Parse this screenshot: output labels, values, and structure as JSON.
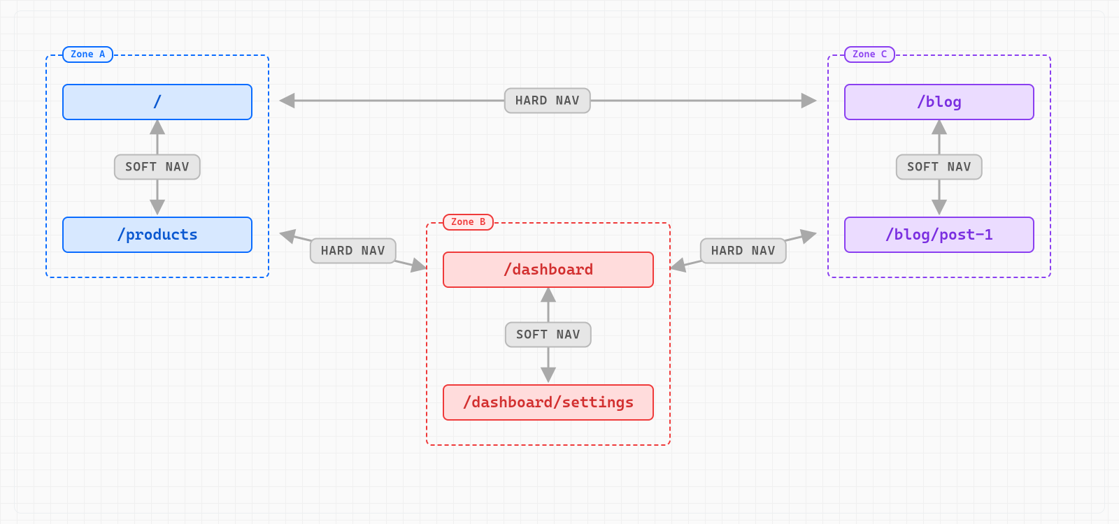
{
  "labels": {
    "soft_nav": "SOFT NAV",
    "hard_nav": "HARD NAV"
  },
  "zones": {
    "a": {
      "title": "Zone A",
      "routes": [
        "/",
        "/products"
      ]
    },
    "b": {
      "title": "Zone B",
      "routes": [
        "/dashboard",
        "/dashboard/settings"
      ]
    },
    "c": {
      "title": "Zone C",
      "routes": [
        "/blog",
        "/blog/post-1"
      ]
    }
  },
  "colors": {
    "zone_a": "#0a6cff",
    "zone_b": "#ef3a3a",
    "zone_c": "#8a3ff0",
    "pill_bg": "#e6e6e6",
    "pill_border": "#b9b9b9",
    "arrow": "#a9a9a9"
  }
}
